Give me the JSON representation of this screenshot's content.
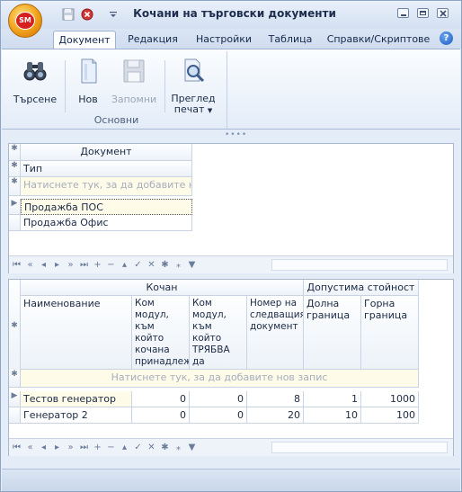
{
  "window": {
    "title": "Кочани на търговски документи",
    "logo_text": "SM"
  },
  "tabs": [
    "Документ",
    "Редакция",
    "Настройки",
    "Таблица",
    "Справки/Скриптове"
  ],
  "ribbon": {
    "search": "Търсене",
    "new": "Нов",
    "save": "Запомни",
    "preview_line1": "Преглед",
    "preview_line2": "печат",
    "group_caption": "Основни"
  },
  "doc_grid": {
    "header": "Документ",
    "sub_header": "Тип",
    "new_row_hint": "Натиснете тук, за да добавите нов за",
    "rows": [
      "Продажба ПОС",
      "Продажба Офис"
    ]
  },
  "gen_grid": {
    "band_left": "Кочан",
    "band_right": "Допустима стойност",
    "columns": [
      "Наименование",
      "Ком модул, към който кочана принадлеж и в МОМЕНТА",
      "Ком модул, към който ТРЯБВА да принадлеж и кочана",
      "Номер на следващия документ",
      "Долна граница",
      "Горна граница"
    ],
    "new_row_hint": "Натиснете тук, за да добавите нов запис",
    "rows": [
      {
        "name": "Тестов генератор",
        "c1": "0",
        "c2": "0",
        "next": "8",
        "low": "1",
        "high": "1000"
      },
      {
        "name": "Генератор 2",
        "c1": "0",
        "c2": "0",
        "next": "20",
        "low": "10",
        "high": "100"
      }
    ]
  },
  "nav_icons": [
    "first",
    "prev-page",
    "prev",
    "next",
    "next-page",
    "last",
    "insert",
    "delete",
    "edit",
    "post",
    "cancel",
    "refresh",
    "save-bookmark",
    "filter"
  ]
}
